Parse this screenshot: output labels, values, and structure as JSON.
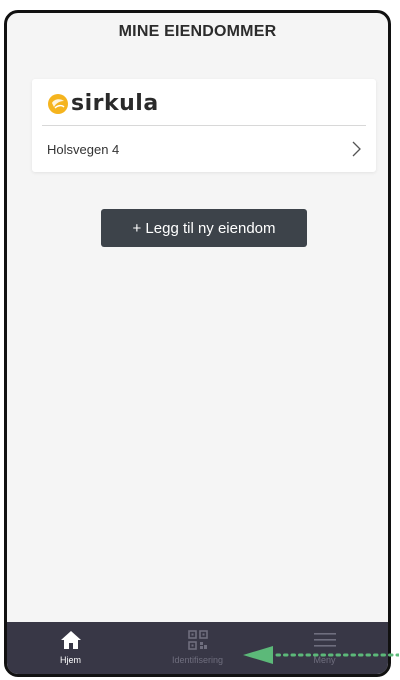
{
  "header": {
    "title": "MINE EIENDOMMER"
  },
  "card": {
    "brand": {
      "name": "sirkula",
      "logo_icon": "sirkula-logo-icon",
      "logo_color": "#f5b41e"
    },
    "properties": [
      {
        "name": "Holsvegen 4"
      }
    ]
  },
  "actions": {
    "add_property_label": "+ Legg til ny eiendom"
  },
  "tabbar": {
    "items": [
      {
        "label": "Hjem",
        "icon": "home-icon",
        "active": true
      },
      {
        "label": "Identifisering",
        "icon": "qr-code-icon",
        "active": false
      },
      {
        "label": "Meny",
        "icon": "menu-icon",
        "active": false
      }
    ]
  },
  "colors": {
    "background": "#f5f5f5",
    "tabbar": "#383746",
    "button": "#3d434a",
    "annotation_arrow": "#5cb979"
  }
}
